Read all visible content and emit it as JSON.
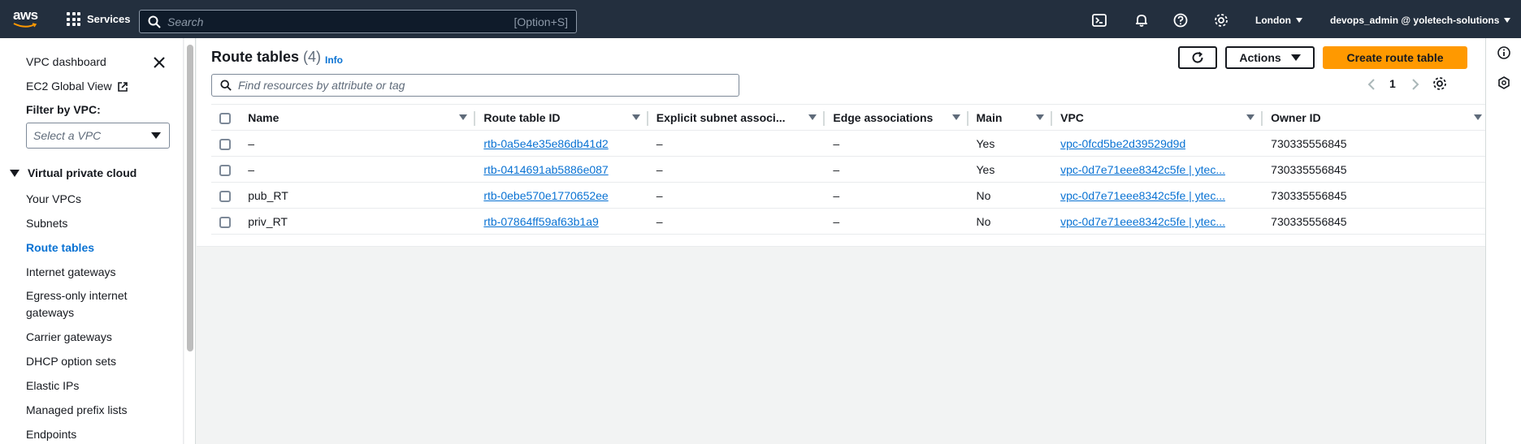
{
  "topnav": {
    "logo_text": "aws",
    "services_label": "Services",
    "search_placeholder": "Search",
    "search_shortcut": "[Option+S]",
    "icons": [
      "cloudshell-icon",
      "bell-icon",
      "help-icon",
      "gear-icon"
    ],
    "region": "London",
    "account": "devops_admin @ yoletech-solutions"
  },
  "sidebar": {
    "dashboard": "VPC dashboard",
    "global_view": "EC2 Global View",
    "filter_label": "Filter by VPC:",
    "filter_placeholder": "Select a VPC",
    "section": "Virtual private cloud",
    "items": [
      {
        "label": "Your VPCs"
      },
      {
        "label": "Subnets"
      },
      {
        "label": "Route tables"
      },
      {
        "label": "Internet gateways"
      },
      {
        "label": "Egress-only internet gateways"
      },
      {
        "label": "Carrier gateways"
      },
      {
        "label": "DHCP option sets"
      },
      {
        "label": "Elastic IPs"
      },
      {
        "label": "Managed prefix lists"
      },
      {
        "label": "Endpoints"
      }
    ]
  },
  "main": {
    "title": "Route tables",
    "count": "(4)",
    "info": "Info",
    "actions_label": "Actions",
    "create_label": "Create route table",
    "filter_placeholder": "Find resources by attribute or tag",
    "page_number": "1",
    "columns": [
      "Name",
      "Route table ID",
      "Explicit subnet associ...",
      "Edge associations",
      "Main",
      "VPC",
      "Owner ID"
    ],
    "rows": [
      {
        "name": "–",
        "id": "rtb-0a5e4e35e86db41d2",
        "explicit": "–",
        "edge": "–",
        "main": "Yes",
        "vpc": "vpc-0fcd5be2d39529d9d",
        "owner": "730335556845"
      },
      {
        "name": "–",
        "id": "rtb-0414691ab5886e087",
        "explicit": "–",
        "edge": "–",
        "main": "Yes",
        "vpc": "vpc-0d7e71eee8342c5fe | ytec...",
        "owner": "730335556845"
      },
      {
        "name": "pub_RT",
        "id": "rtb-0ebe570e1770652ee",
        "explicit": "–",
        "edge": "–",
        "main": "No",
        "vpc": "vpc-0d7e71eee8342c5fe | ytec...",
        "owner": "730335556845"
      },
      {
        "name": "priv_RT",
        "id": "rtb-07864ff59af63b1a9",
        "explicit": "–",
        "edge": "–",
        "main": "No",
        "vpc": "vpc-0d7e71eee8342c5fe | ytec...",
        "owner": "730335556845"
      }
    ]
  },
  "colors": {
    "nav_bg": "#232f3e",
    "link": "#0972d3",
    "primary_button": "#ff9900"
  }
}
